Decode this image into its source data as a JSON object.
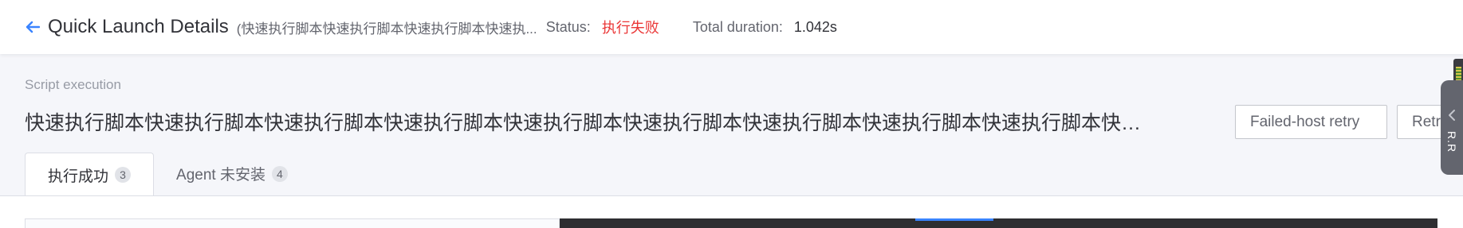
{
  "header": {
    "title": "Quick Launch Details",
    "script_name": "(快速执行脚本快速执行脚本快速执行脚本快速执...",
    "status_label": "Status:",
    "status_value": "执行失败",
    "duration_label": "Total duration:",
    "duration_value": "1.042s",
    "status_color": "#ea3636"
  },
  "step": {
    "section_label": "Script execution",
    "title": "快速执行脚本快速执行脚本快速执行脚本快速执行脚本快速执行脚本快速执行脚本快速执行脚本快速执行脚本快速执行脚本快速执行脚本快速执行脚本快...",
    "buttons": {
      "retry_failed": "Failed-host retry",
      "retry_all": "Retr"
    }
  },
  "tabs": [
    {
      "label": "执行成功",
      "count": "3"
    },
    {
      "label": "Agent 未安装",
      "count": "4"
    }
  ],
  "side_tool": {
    "label": "R.R"
  },
  "icons": {
    "back": "arrow-left-icon",
    "side_tool": "chevron-left-icon"
  },
  "colors": {
    "accent": "#3a84ff",
    "failure": "#ea3636",
    "log_background": "#2e2e31"
  }
}
